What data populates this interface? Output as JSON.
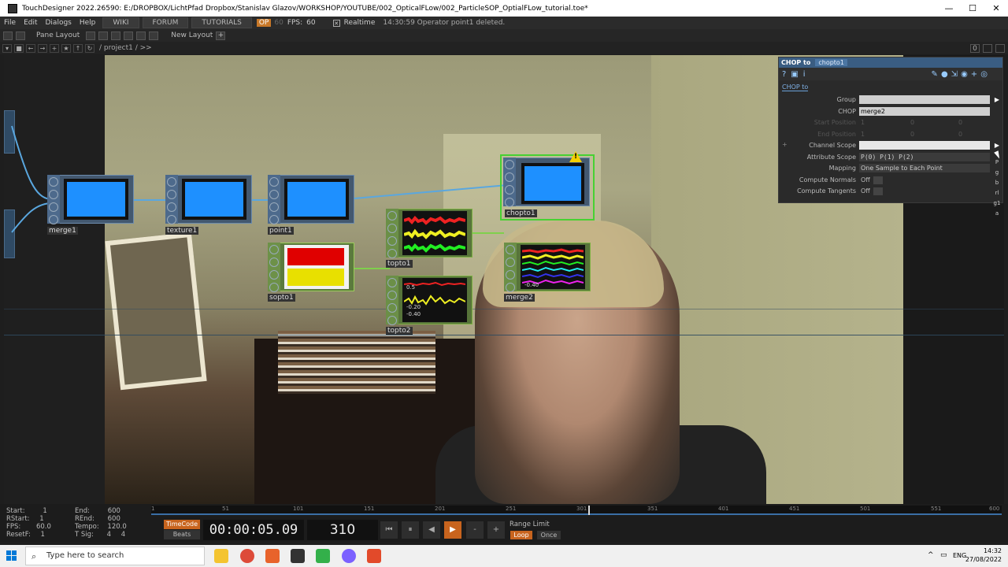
{
  "window": {
    "title": "TouchDesigner 2022.26590: E:/DROPBOX/LichtPfad Dropbox/Stanislav Glazov/WORKSHOP/YOUTUBE/002_OpticalFLow/002_ParticleSOP_OptialFLow_tutorial.toe*",
    "controls": [
      "—",
      "☐",
      "✕"
    ]
  },
  "menubar": {
    "items": [
      "File",
      "Edit",
      "Dialogs",
      "Help"
    ],
    "wiki": "WIKI",
    "forum": "FORUM",
    "tutorials": "TUTORIALS",
    "op_badge": "OP",
    "fps_dim": "60",
    "fps_label": "FPS:",
    "fps_value": "60",
    "realtime": "Realtime",
    "status_message": "14:30:59 Operator point1 deleted."
  },
  "panebar": {
    "pane_layout": "Pane Layout",
    "new_layout": "New Layout",
    "plus": "+"
  },
  "pathbar": {
    "path": "/ project1 / >>",
    "right": "0"
  },
  "nodes": [
    {
      "id": "merge1",
      "label": "merge1"
    },
    {
      "id": "texture1",
      "label": "texture1"
    },
    {
      "id": "point1",
      "label": "point1"
    },
    {
      "id": "sopto1",
      "label": "sopto1"
    },
    {
      "id": "topto1",
      "label": "topto1"
    },
    {
      "id": "topto2",
      "label": "topto2"
    },
    {
      "id": "chopto1",
      "label": "chopto1"
    },
    {
      "id": "merge2",
      "label": "merge2"
    }
  ],
  "graph_labels": {
    "topto2_a": "0.5",
    "topto2_b": "-0.20",
    "topto2_c": "-0.40",
    "merge2_a": "-0.40"
  },
  "params": {
    "op_type": "CHOP to",
    "op_name": "chopto1",
    "page_tab": "CHOP to",
    "rows": [
      {
        "label": "Group",
        "value": ""
      },
      {
        "label": "CHOP",
        "value": "merge2"
      },
      {
        "label": "Start Position",
        "value": "1",
        "v2": "0",
        "v3": "0"
      },
      {
        "label": "End Position",
        "value": "1",
        "v2": "0",
        "v3": "0"
      },
      {
        "label": "Channel Scope",
        "value": ""
      },
      {
        "label": "Attribute Scope",
        "value": "P(0) P(1) P(2)"
      },
      {
        "label": "Mapping",
        "value": "One Sample to Each Point"
      },
      {
        "label": "Compute Normals",
        "value": "Off"
      },
      {
        "label": "Compute Tangents",
        "value": "Off"
      }
    ],
    "side_letters": [
      "P",
      "g",
      "b",
      "rl",
      "g1",
      "a"
    ]
  },
  "timeline": {
    "start_label": "Start:",
    "start": "1",
    "rstart_label": "RStart:",
    "rstart": "1",
    "fps_label": "FPS:",
    "fps": "60.0",
    "resetf_label": "ResetF:",
    "resetf": "1",
    "end_label": "End:",
    "end": "600",
    "rend_label": "REnd:",
    "rend": "600",
    "tempo_label": "Tempo:",
    "tempo": "120.0",
    "tsig_label": "T Sig:",
    "tsig_a": "4",
    "tsig_b": "4",
    "ruler": [
      "1",
      "51",
      "101",
      "151",
      "201",
      "251",
      "301",
      "351",
      "401",
      "451",
      "501",
      "551",
      "600"
    ],
    "timecode": "TimeCode",
    "beats": "Beats",
    "time": "00:00:05.09",
    "frame": "310",
    "range_limit": "Range Limit",
    "loop": "Loop",
    "once": "Once"
  },
  "taskbar": {
    "search_placeholder": "Type here to search",
    "lang": "ENG",
    "time": "14:32",
    "date": "27/08/2022"
  }
}
